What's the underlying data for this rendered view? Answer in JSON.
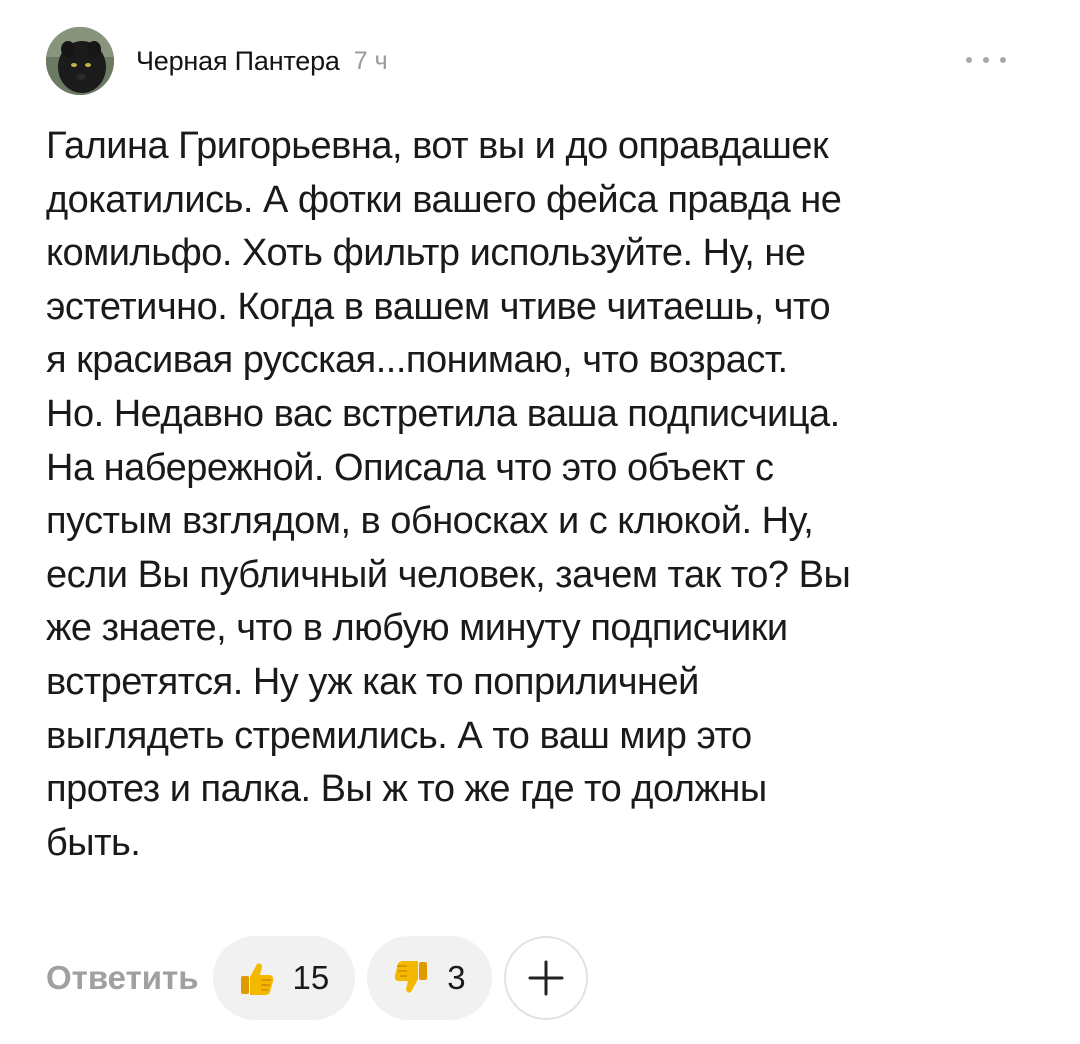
{
  "author": {
    "name": "Черная Пантера",
    "time": "7 ч",
    "avatar_icon": "black-panther-avatar"
  },
  "comment": {
    "text": "Галина Григорьевна, вот вы и до оправдашек\nдокатились. А фотки вашего фейса правда не\nкомильфо. Хоть фильтр используйте. Ну, не\nэстетично. Когда в вашем чтиве читаешь, что\nя красивая русская...понимаю, что возраст.\nНо. Недавно вас встретила ваша подписчица.\nНа набережной. Описала что это объект с\nпустым взглядом, в обносках и с клюкой. Ну,\nесли Вы публичный человек, зачем так то? Вы\nже знаете, что в любую минуту подписчики\nвстретятся. Ну уж как то поприличней\nвыглядеть стремились. А то ваш мир это\nпротез и палка. Вы ж то же где то должны\nбыть."
  },
  "actions": {
    "reply_label": "Ответить",
    "likes": "15",
    "dislikes": "3",
    "like_icon": "thumbs-up-emoji",
    "dislike_icon": "thumbs-down-emoji",
    "add_icon": "plus-icon",
    "more_icon": "more-dots-icon"
  },
  "colors": {
    "time": "#9a9a9a",
    "reply": "#a0a0a0",
    "pill_bg": "#f1f1f1",
    "emoji_yellow": "#f5b800"
  }
}
